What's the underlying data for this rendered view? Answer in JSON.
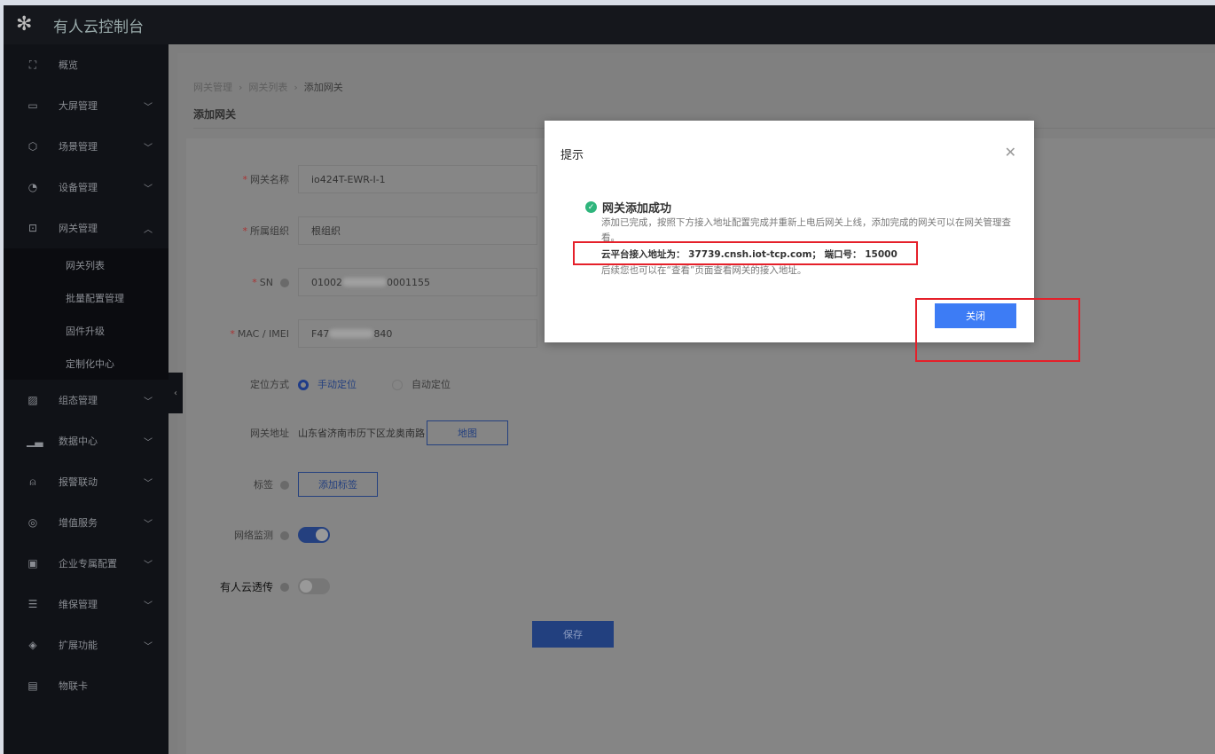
{
  "app": {
    "title": "有人云控制台"
  },
  "sidebar": {
    "items": [
      {
        "label": "概览",
        "icon": "overview-icon",
        "chev": ""
      },
      {
        "label": "大屏管理",
        "icon": "screen-icon",
        "chev": "v"
      },
      {
        "label": "场景管理",
        "icon": "cube-icon",
        "chev": "v"
      },
      {
        "label": "设备管理",
        "icon": "pie-icon",
        "chev": "v"
      },
      {
        "label": "网关管理",
        "icon": "gateway-icon",
        "chev": "^"
      }
    ],
    "sub": [
      "网关列表",
      "批量配置管理",
      "固件升级",
      "定制化中心"
    ],
    "items2": [
      {
        "label": "组态管理",
        "icon": "image-icon"
      },
      {
        "label": "数据中心",
        "icon": "bar-chart-icon"
      },
      {
        "label": "报警联动",
        "icon": "alarm-icon"
      },
      {
        "label": "增值服务",
        "icon": "value-icon"
      },
      {
        "label": "企业专属配置",
        "icon": "enterprise-icon"
      },
      {
        "label": "维保管理",
        "icon": "maintenance-icon"
      },
      {
        "label": "扩展功能",
        "icon": "layers-icon"
      },
      {
        "label": "物联卡",
        "icon": "sim-icon"
      }
    ]
  },
  "breadcrumb": [
    "网关管理",
    "网关列表",
    "添加网关"
  ],
  "page": {
    "title": "添加网关"
  },
  "form": {
    "name_label": "网关名称",
    "name_value": "io424T-EWR-I-1",
    "org_label": "所属组织",
    "org_value": "根组织",
    "sn_label": "SN",
    "sn_prefix": "01002",
    "sn_suffix": "0001155",
    "mac_label": "MAC / IMEI",
    "mac_prefix": "F47",
    "mac_suffix": "840",
    "loc_label": "定位方式",
    "loc_manual": "手动定位",
    "loc_auto": "自动定位",
    "addr_label": "网关地址",
    "addr_value": "山东省济南市历下区龙奥南路",
    "map_btn": "地图",
    "tag_label": "标签",
    "tag_btn": "添加标签",
    "net_label": "网络监测",
    "net_on": true,
    "trans_label": "有人云透传",
    "trans_on": false,
    "save": "保存"
  },
  "modal": {
    "title": "提示",
    "heading": "网关添加成功",
    "text": "添加已完成，按照下方接入地址配置完成并重新上电后网关上线，添加完成的网关可以在网关管理查看。",
    "addr_label": "云平台接入地址为：",
    "addr": "37739.cnsh.iot-tcp.com；",
    "port_label": "端口号：",
    "port": "15000",
    "note": "后续您也可以在“查看”页面查看网关的接入地址。",
    "close": "关闭"
  },
  "colors": {
    "accent": "#3d7cf5",
    "success": "#2fb57c",
    "highlight": "#e5202a"
  }
}
